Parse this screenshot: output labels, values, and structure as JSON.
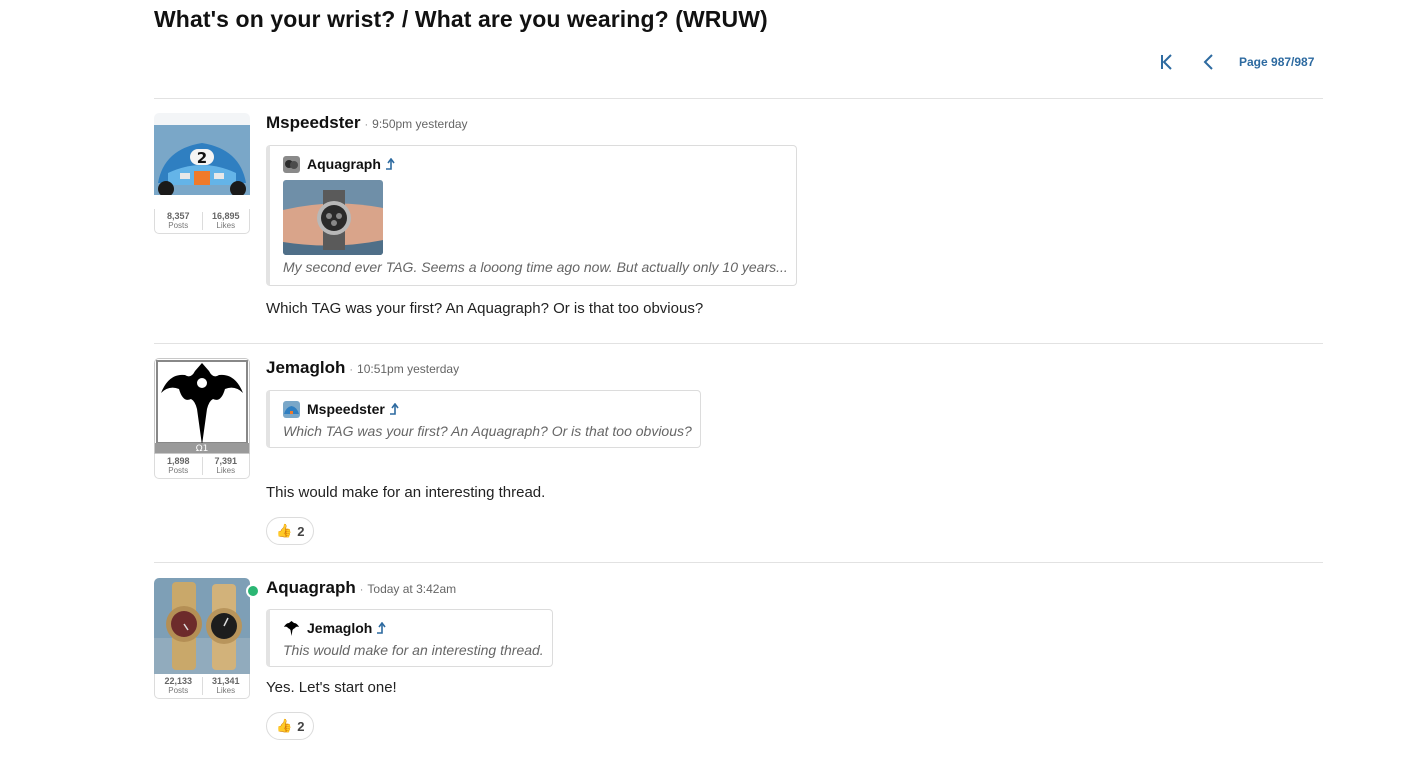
{
  "thread": {
    "title": "What's on your wrist? / What are you wearing? (WRUW)"
  },
  "pagination": {
    "label": "Page 987/987",
    "first_icon": "first-page-icon",
    "prev_icon": "chevron-left-icon"
  },
  "posts": [
    {
      "author": "Mspeedster",
      "time": "9:50pm yesterday",
      "avatar_icon": "race-car-avatar",
      "stats": {
        "posts": "8,357",
        "posts_label": "Posts",
        "likes": "16,895",
        "likes_label": "Likes"
      },
      "quote": {
        "author": "Aquagraph",
        "text": "My second ever TAG. Seems a looong time ago now. But actually only 10 years..."
      },
      "message": "Which TAG was your first? An Aquagraph? Or is that too obvious?"
    },
    {
      "author": "Jemagloh",
      "time": "10:51pm yesterday",
      "avatar_icon": "queensryche-logo-avatar",
      "avatar_caption": "Ω1",
      "stats": {
        "posts": "1,898",
        "posts_label": "Posts",
        "likes": "7,391",
        "likes_label": "Likes"
      },
      "quote": {
        "author": "Mspeedster",
        "text": "Which TAG was your first? An Aquagraph? Or is that too obvious?"
      },
      "message": "This would make for an interesting thread.",
      "reaction": {
        "icon": "thumbs-up-icon",
        "emoji": "👍",
        "count": "2"
      }
    },
    {
      "author": "Aquagraph",
      "time": "Today at 3:42am",
      "avatar_icon": "two-watches-avatar",
      "online": true,
      "stats": {
        "posts": "22,133",
        "posts_label": "Posts",
        "likes": "31,341",
        "likes_label": "Likes"
      },
      "quote": {
        "author": "Jemagloh",
        "text": "This would make for an interesting thread."
      },
      "message": "Yes. Let's start one!",
      "reaction": {
        "icon": "thumbs-up-icon",
        "emoji": "👍",
        "count": "2"
      }
    }
  ]
}
